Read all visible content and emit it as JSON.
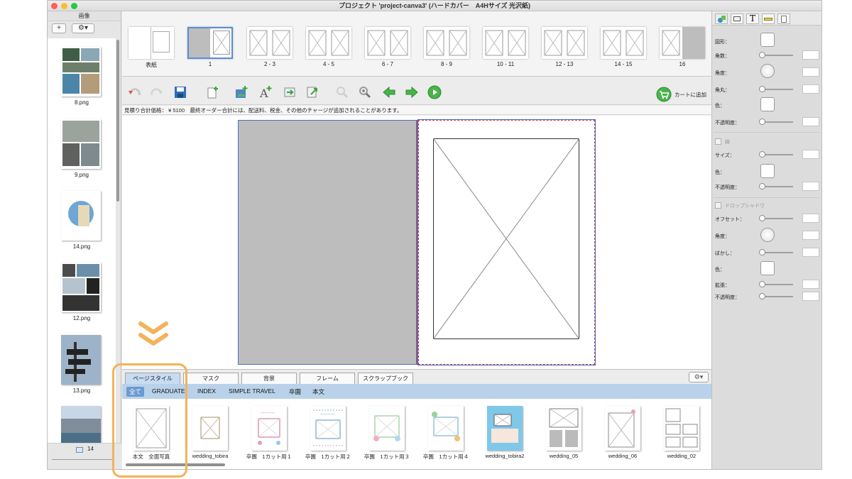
{
  "window": {
    "title": "プロジェクト 'project-canva3' (ハードカバー　A4Hサイズ 光沢紙)"
  },
  "sidebar": {
    "header": "画像",
    "add_label": "+",
    "gear_label": "⚙▾",
    "thumbs": [
      {
        "label": "8.png"
      },
      {
        "label": "9.png"
      },
      {
        "label": "14.png"
      },
      {
        "label": "12.png"
      },
      {
        "label": "13.png"
      },
      {
        "label": ""
      }
    ],
    "footer_count": "14"
  },
  "pages": [
    {
      "label": "表紙"
    },
    {
      "label": "1"
    },
    {
      "label": "2 - 3"
    },
    {
      "label": "4 - 5"
    },
    {
      "label": "6 - 7"
    },
    {
      "label": "8 - 9"
    },
    {
      "label": "10 - 11"
    },
    {
      "label": "12 - 13"
    },
    {
      "label": "14 - 15"
    },
    {
      "label": "16"
    }
  ],
  "toolbar": {
    "cart_label": "カートに追加"
  },
  "notice": "見積り合計価格： ¥ 5100　最終オーダー合計には、配送料、税金、その他のチャージが追加されることがあります。",
  "tabs": [
    {
      "label": "ページスタイル",
      "active": true
    },
    {
      "label": "マスク"
    },
    {
      "label": "背景"
    },
    {
      "label": "フレーム"
    },
    {
      "label": "スクラップブック"
    }
  ],
  "filters": [
    {
      "label": "全て",
      "active": true
    },
    {
      "label": "GRADUATE"
    },
    {
      "label": "INDEX"
    },
    {
      "label": "SIMPLE TRAVEL"
    },
    {
      "label": "卒園"
    },
    {
      "label": "本文"
    }
  ],
  "styles": [
    {
      "label": "本文　全面写真"
    },
    {
      "label": "wedding_tobira"
    },
    {
      "label": "卒園　1カット用１"
    },
    {
      "label": "卒園　1カット用２"
    },
    {
      "label": "卒園　1カット用３"
    },
    {
      "label": "卒園　1カット用４"
    },
    {
      "label": "wedding_tobira2"
    },
    {
      "label": "wedding_05"
    },
    {
      "label": "wedding_06"
    },
    {
      "label": "wedding_02"
    }
  ],
  "rpanel": {
    "shape_label": "図形：",
    "corners_label": "角数：",
    "angle_label": "角度：",
    "round_label": "角丸：",
    "color_label": "色：",
    "opacity_label": "不透明度：",
    "border_label": "線",
    "size_label": "サイズ：",
    "color2_label": "色：",
    "opacity2_label": "不透明度：",
    "shadow_label": "ドロップシャドウ",
    "offset_label": "オフセット：",
    "angle2_label": "角度：",
    "blur_label": "ぼかし：",
    "color3_label": "色：",
    "expand_label": "拡張：",
    "opacity3_label": "不透明度："
  },
  "colors": {
    "accent_orange": "#f4b25a",
    "filter_bar": "#b9d2ea",
    "gray_page": "#bdbdbd"
  }
}
